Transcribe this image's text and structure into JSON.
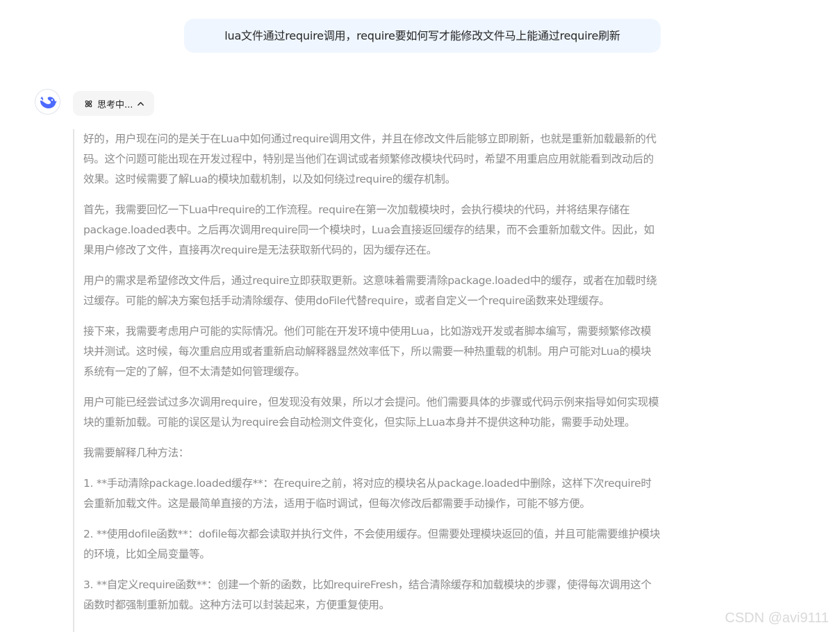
{
  "user_message": {
    "text": "lua文件通过require调用，require要如何写才能修改文件马上能通过require刷新"
  },
  "assistant": {
    "avatar_icon": "whale-logo-icon",
    "brand_color": "#4d6bfe",
    "thinking_toggle": {
      "label": "思考中...",
      "icon": "atom-icon",
      "chevron_icon": "chevron-up-icon"
    },
    "thinking_paragraphs": [
      "好的，用户现在问的是关于在Lua中如何通过require调用文件，并且在修改文件后能够立即刷新，也就是重新加载最新的代码。这个问题可能出现在开发过程中，特别是当他们在调试或者频繁修改模块代码时，希望不用重启应用就能看到改动后的效果。这时候需要了解Lua的模块加载机制，以及如何绕过require的缓存机制。",
      "首先，我需要回忆一下Lua中require的工作流程。require在第一次加载模块时，会执行模块的代码，并将结果存储在package.loaded表中。之后再次调用require同一个模块时，Lua会直接返回缓存的结果，而不会重新加载文件。因此，如果用户修改了文件，直接再次require是无法获取新代码的，因为缓存还在。",
      "用户的需求是希望修改文件后，通过require立即获取更新。这意味着需要清除package.loaded中的缓存，或者在加载时绕过缓存。可能的解决方案包括手动清除缓存、使用doFile代替require，或者自定义一个require函数来处理缓存。",
      "接下来，我需要考虑用户可能的实际情况。他们可能在开发环境中使用Lua，比如游戏开发或者脚本编写，需要频繁修改模块并测试。这时候，每次重启应用或者重新启动解释器显然效率低下，所以需要一种热重载的机制。用户可能对Lua的模块系统有一定的了解，但不太清楚如何管理缓存。",
      "用户可能已经尝试过多次调用require，但发现没有效果，所以才会提问。他们需要具体的步骤或代码示例来指导如何实现模块的重新加载。可能的误区是认为require会自动检测文件变化，但实际上Lua本身并不提供这种功能，需要手动处理。",
      "我需要解释几种方法：",
      "1. **手动清除package.loaded缓存**：在require之前，将对应的模块名从package.loaded中删除，这样下次require时会重新加载文件。这是最简单直接的方法，适用于临时调试，但每次修改后都需要手动操作，可能不够方便。",
      "2. **使用dofile函数**：dofile每次都会读取并执行文件，不会使用缓存。但需要处理模块返回的值，并且可能需要维护模块的环境，比如全局变量等。",
      "3. **自定义require函数**：创建一个新的函数，比如requireFresh，结合清除缓存和加载模块的步骤，使得每次调用这个函数时都强制重新加载。这种方法可以封装起来，方便重复使用。"
    ]
  },
  "watermark": {
    "text": "CSDN @avi9111"
  }
}
